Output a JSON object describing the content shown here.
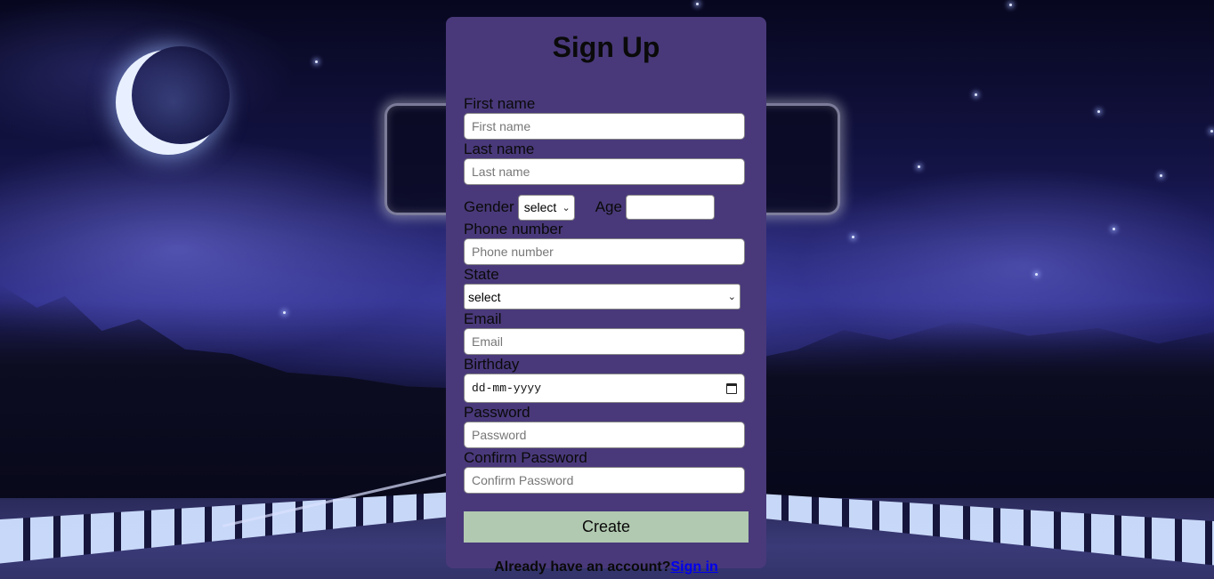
{
  "form": {
    "title": "Sign Up",
    "first_name": {
      "label": "First name",
      "placeholder": "First name"
    },
    "last_name": {
      "label": "Last name",
      "placeholder": "Last name"
    },
    "gender": {
      "label": "Gender",
      "value": "select"
    },
    "age": {
      "label": "Age",
      "value": ""
    },
    "phone": {
      "label": "Phone number",
      "placeholder": "Phone number"
    },
    "state": {
      "label": "State",
      "value": "select"
    },
    "email": {
      "label": "Email",
      "placeholder": "Email"
    },
    "birthday": {
      "label": "Birthday",
      "placeholder": "dd-mm-yyyy"
    },
    "password": {
      "label": "Password",
      "placeholder": "Password"
    },
    "confirm_password": {
      "label": "Confirm Password",
      "placeholder": "Confirm Password"
    },
    "submit_label": "Create",
    "footer_text": "Already have an account?",
    "signin_link": "Sign in"
  },
  "icons": {
    "select_arrow": "chevron-down-icon",
    "date_picker": "calendar-icon"
  },
  "colors": {
    "card_bg": "#49397a",
    "button_bg": "#b1c9b0",
    "link": "#0000ee"
  }
}
